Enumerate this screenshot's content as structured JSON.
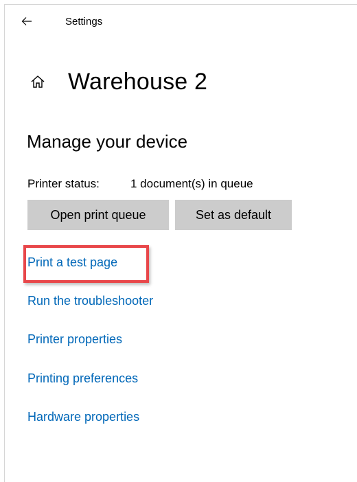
{
  "titlebar": {
    "back_icon": "arrow-left-icon",
    "app_title": "Settings"
  },
  "header": {
    "home_icon": "home-icon",
    "title": "Warehouse 2"
  },
  "section": {
    "heading": "Manage your device"
  },
  "status": {
    "label": "Printer status:",
    "value": "1 document(s) in queue"
  },
  "buttons": {
    "open_queue": "Open print queue",
    "set_default": "Set as default"
  },
  "links": [
    {
      "label": "Print a test page",
      "highlighted": true
    },
    {
      "label": "Run the troubleshooter"
    },
    {
      "label": "Printer properties"
    },
    {
      "label": "Printing preferences"
    },
    {
      "label": "Hardware properties"
    }
  ],
  "colors": {
    "link": "#0067b8",
    "button_bg": "#cccccc",
    "highlight_border": "#e8474a"
  }
}
